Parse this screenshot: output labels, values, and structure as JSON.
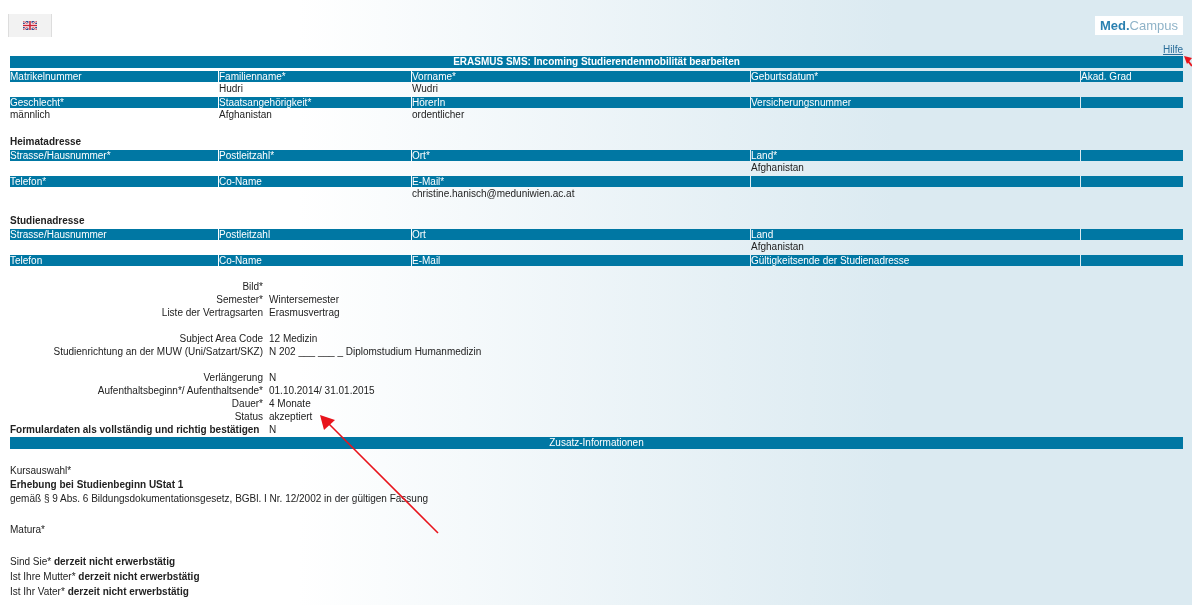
{
  "logo": [
    "Med.",
    "Campus"
  ],
  "help_link": "Hilfe",
  "title": "ERASMUS SMS: Incoming Studierendenmobilität bearbeiten",
  "personal": [
    {
      "kind": "header",
      "cells": [
        "Matrikelnummer",
        "Familienname*",
        "Vorname*",
        "Geburtsdatum*",
        "Akad. Grad"
      ]
    },
    {
      "kind": "value",
      "cells": [
        null,
        "Hudri",
        "Wudri",
        null,
        null
      ]
    },
    {
      "kind": "header",
      "cells": [
        "Geschlecht*",
        "Staatsangehörigkeit*",
        "HörerIn",
        "Versicherungsnummer",
        null
      ]
    },
    {
      "kind": "value",
      "cells": [
        "männlich",
        "Afghanistan",
        "ordentlicher",
        null,
        null
      ]
    }
  ],
  "addresses": [
    {
      "heading": "Heimatadresse",
      "rows": [
        {
          "kind": "header",
          "cells": [
            "Strasse/Hausnummer*",
            "Postleitzahl*",
            "Ort*",
            "Land*",
            null
          ]
        },
        {
          "kind": "value",
          "cells": [
            null,
            null,
            null,
            "Afghanistan",
            null
          ]
        },
        {
          "kind": "header",
          "cells": [
            "Telefon*",
            "Co-Name",
            "E-Mail*",
            null,
            null
          ]
        },
        {
          "kind": "value",
          "cells": [
            null,
            null,
            "christine.hanisch@meduniwien.ac.at",
            null,
            null
          ]
        }
      ]
    },
    {
      "heading": "Studienadresse",
      "rows": [
        {
          "kind": "header",
          "cells": [
            "Strasse/Hausnummer",
            "Postleitzahl",
            "Ort",
            "Land",
            null
          ]
        },
        {
          "kind": "value",
          "cells": [
            null,
            null,
            null,
            "Afghanistan",
            null
          ]
        },
        {
          "kind": "header",
          "cells": [
            "Telefon",
            "Co-Name",
            "E-Mail",
            "Gültigkeitsende der Studienadresse",
            null
          ]
        }
      ]
    }
  ],
  "detail_groups": [
    {
      "fields": [
        {
          "label": "Bild*"
        },
        {
          "label": "Semester*",
          "value": "Wintersemester"
        },
        {
          "label": "Liste der Vertragsarten",
          "value": "Erasmusvertrag"
        }
      ]
    },
    {
      "fields": [
        {
          "label": "Subject Area Code",
          "value": "12 Medizin"
        },
        {
          "label": "Studienrichtung an der MUW (Uni/Satzart/SKZ)",
          "value": "N 202 ___ ___ _ Diplomstudium Humanmedizin"
        }
      ]
    },
    {
      "fields": [
        {
          "label": "Verlängerung",
          "value": "N"
        },
        {
          "label": "Aufenthaltsbeginn*/ Aufenthaltsende*",
          "value": "01.10.2014/ 31.01.2015"
        },
        {
          "label": "Dauer*",
          "value": "4 Monate"
        },
        {
          "label": "Status",
          "value": "akzeptiert"
        }
      ]
    }
  ],
  "confirmation": {
    "label": "Formulardaten als vollständig und richtig bestätigen",
    "value": "N"
  },
  "extra_bar": "Zusatz-Informationen",
  "extra_lines": [
    {
      "kind": "label",
      "text": "Kursauswahl*"
    },
    {
      "kind": "heading",
      "text": "Erhebung bei Studienbeginn UStat 1"
    },
    {
      "kind": "text",
      "text": "gemäß § 9 Abs. 6 Bildungsdokumentationsgesetz, BGBl. I Nr. 12/2002 in der gültigen Fassung"
    },
    {
      "kind": "label",
      "text": "Matura*"
    }
  ],
  "answers": [
    {
      "question": "Sind Sie*",
      "answer": "derzeit nicht erwerbstätig"
    },
    {
      "question": "Ist Ihre Mutter*",
      "answer": "derzeit nicht erwerbstätig"
    },
    {
      "question": "Ist Ihr Vater*",
      "answer": "derzeit nicht erwerbstätig"
    }
  ]
}
